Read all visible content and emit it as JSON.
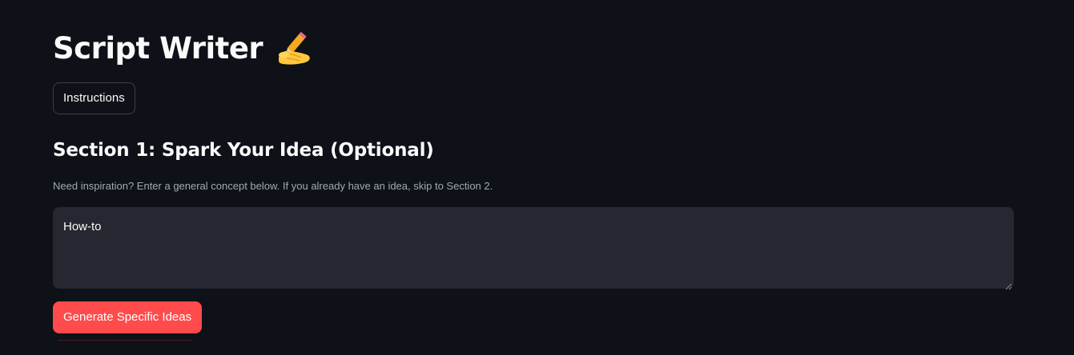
{
  "header": {
    "title": "Script Writer",
    "title_icon": "writing-hand-emoji"
  },
  "instructions_button": {
    "label": "Instructions"
  },
  "section1": {
    "title": "Section 1: Spark Your Idea (Optional)",
    "caption": "Need inspiration? Enter a general concept below. If you already have an idea, skip to Section 2.",
    "concept_input": {
      "value": "How-to"
    },
    "generate_button": {
      "label": "Generate Specific Ideas"
    }
  },
  "colors": {
    "background": "#0e1117",
    "input_background": "#262730",
    "primary_button": "#ff4b4b",
    "text": "#fafafa",
    "caption_text": "#a3a8b8"
  }
}
